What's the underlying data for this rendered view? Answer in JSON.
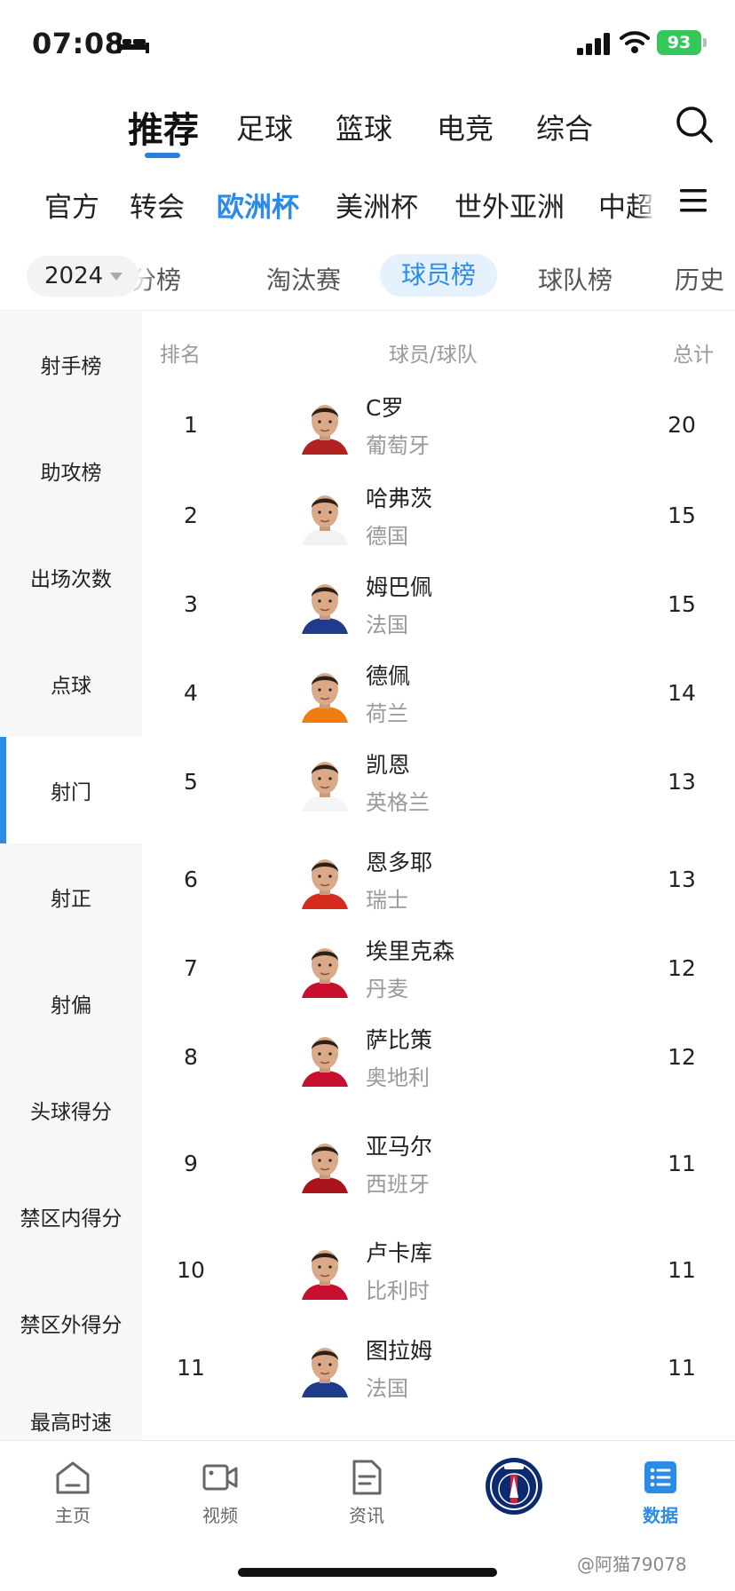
{
  "status_bar": {
    "time": "07:08",
    "battery": "93"
  },
  "top_nav": {
    "tabs": [
      {
        "label": "推荐",
        "active": true
      },
      {
        "label": "足球"
      },
      {
        "label": "篮球"
      },
      {
        "label": "电竞"
      },
      {
        "label": "综合"
      }
    ],
    "search_icon": "search-icon"
  },
  "league_nav": {
    "items": [
      {
        "label": "官方"
      },
      {
        "label": "转会"
      },
      {
        "label": "欧洲杯",
        "active": true
      },
      {
        "label": "美洲杯"
      },
      {
        "label": "世外亚洲"
      },
      {
        "label": "中超"
      }
    ],
    "menu_icon": "menu-icon"
  },
  "sub_nav": {
    "year": "2024",
    "items": [
      {
        "label": "积分榜"
      },
      {
        "label": "淘汰赛"
      },
      {
        "label": "球员榜",
        "active": true
      },
      {
        "label": "球队榜"
      },
      {
        "label": "历史"
      }
    ]
  },
  "side_menu": {
    "items": [
      {
        "label": "射手榜"
      },
      {
        "label": "助攻榜"
      },
      {
        "label": "出场次数"
      },
      {
        "label": "点球"
      },
      {
        "label": "射门",
        "active": true
      },
      {
        "label": "射正"
      },
      {
        "label": "射偏"
      },
      {
        "label": "头球得分"
      },
      {
        "label": "禁区内得分"
      },
      {
        "label": "禁区外得分"
      },
      {
        "label": "最高时速"
      }
    ]
  },
  "table": {
    "headers": {
      "rank": "排名",
      "player": "球员/球队",
      "total": "总计"
    },
    "rows": [
      {
        "rank": "1",
        "name": "C罗",
        "team": "葡萄牙",
        "total": "20",
        "kit_color": "#b22222"
      },
      {
        "rank": "2",
        "name": "哈弗茨",
        "team": "德国",
        "total": "15",
        "kit_color": "#f2f2f2"
      },
      {
        "rank": "3",
        "name": "姆巴佩",
        "team": "法国",
        "total": "15",
        "kit_color": "#1f3b8c"
      },
      {
        "rank": "4",
        "name": "德佩",
        "team": "荷兰",
        "total": "14",
        "kit_color": "#f07c12"
      },
      {
        "rank": "5",
        "name": "凯恩",
        "team": "英格兰",
        "total": "13",
        "kit_color": "#f5f5f5"
      },
      {
        "rank": "6",
        "name": "恩多耶",
        "team": "瑞士",
        "total": "13",
        "kit_color": "#d52b1e"
      },
      {
        "rank": "7",
        "name": "埃里克森",
        "team": "丹麦",
        "total": "12",
        "kit_color": "#c8102e"
      },
      {
        "rank": "8",
        "name": "萨比策",
        "team": "奥地利",
        "total": "12",
        "kit_color": "#c8102e"
      },
      {
        "rank": "9",
        "name": "亚马尔",
        "team": "西班牙",
        "total": "11",
        "kit_color": "#aa151b"
      },
      {
        "rank": "10",
        "name": "卢卡库",
        "team": "比利时",
        "total": "11",
        "kit_color": "#c8102e"
      },
      {
        "rank": "11",
        "name": "图拉姆",
        "team": "法国",
        "total": "11",
        "kit_color": "#1f3b8c"
      }
    ]
  },
  "bottom_bar": {
    "items": [
      {
        "label": "主页",
        "icon": "home-icon"
      },
      {
        "label": "视频",
        "icon": "video-icon"
      },
      {
        "label": "资讯",
        "icon": "news-icon"
      },
      {
        "label": "",
        "icon": "club-logo"
      },
      {
        "label": "数据",
        "icon": "data-icon",
        "active": true
      }
    ]
  },
  "watermark": "@阿猫79078",
  "colors": {
    "accent": "#2a8be8",
    "battery": "#34c759"
  }
}
